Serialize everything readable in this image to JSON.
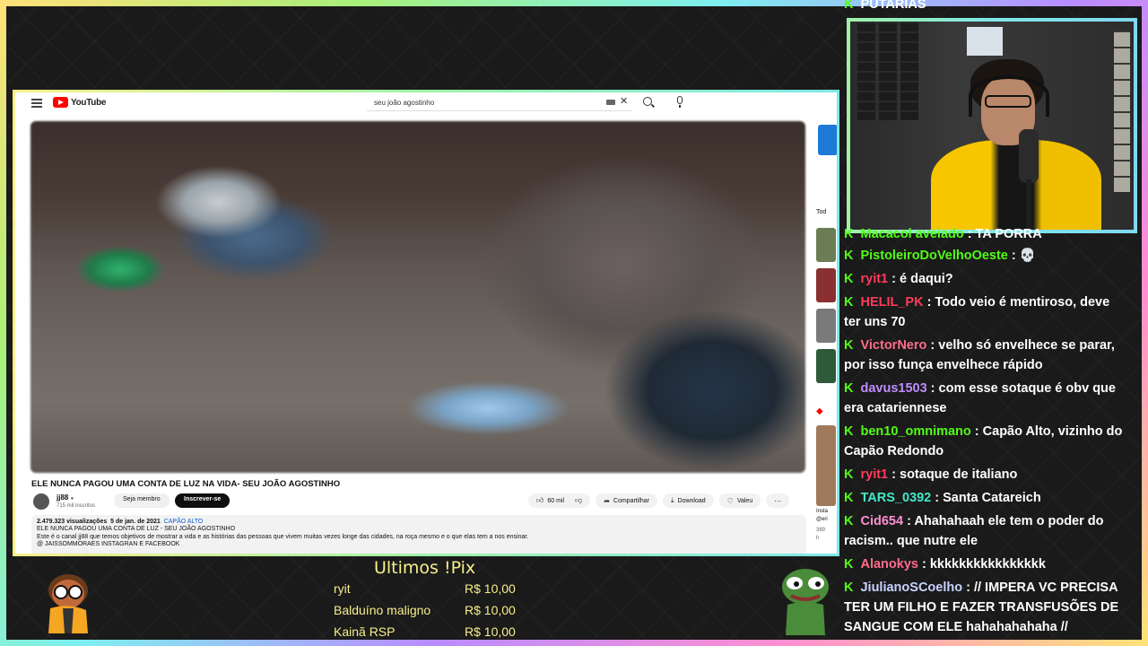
{
  "youtube": {
    "search_value": "seu joão agostinho",
    "logo_text": "YouTube",
    "video_title": "ELE NUNCA PAGOU UMA CONTA DE LUZ NA VIDA- SEU JOÃO AGOSTINHO",
    "channel_name": "jj88",
    "channel_subs": "715 mil inscritos",
    "member_label": "Seja membro",
    "subscribe_label": "Inscrever-se",
    "likes": "60 mil",
    "share_label": "Compartilhar",
    "download_label": "Download",
    "thanks_label": "Valeu",
    "views": "2.479.323 visualizações",
    "date": "5 de jan. de 2021",
    "location_tag": "CAPÃO ALTO",
    "desc_line1": "ELE NUNCA PAGOU UMA CONTA DE LUZ - SEU JOÃO AGOSTINHO",
    "desc_line2": "Este é o canal jj88 que temos objetivos de mostrar a vida e as histórias das pessoas que vivem muitas vezes longe das cidades, na roça mesmo e o que elas tem a nos ensinar.",
    "desc_line3": "@ JAISSOMMORAES INSTAGRAN E FACEBOOK",
    "right_filter": "Tod",
    "right_text1": "Insta",
    "right_text2": "@eri",
    "right_text3": "389",
    "right_text4": "h"
  },
  "chat": {
    "partial_top": "PUTARIAS",
    "messages": [
      {
        "user": "Macacol aveiado",
        "color": "#53fc18",
        "text": "TA PORRA"
      },
      {
        "user": "PistoleiroDoVelhoOeste",
        "color": "#53fc18",
        "text": "💀"
      },
      {
        "user": "ryit1",
        "color": "#ff3b5c",
        "text": "é daqui?"
      },
      {
        "user": "HELIL_PK",
        "color": "#ff3b5c",
        "text": "Todo veio é mentiroso, deve ter uns 70"
      },
      {
        "user": "VictorNero",
        "color": "#ff6b8a",
        "text": "velho só envelhece se parar, por isso funça envelhece rápido"
      },
      {
        "user": "davus1503",
        "color": "#c08cff",
        "text": "com esse sotaque é obv que era catariennese"
      },
      {
        "user": "ben10_omnimano",
        "color": "#53fc18",
        "text": "Capão Alto, vizinho do Capão Redondo"
      },
      {
        "user": "ryit1",
        "color": "#ff3b5c",
        "text": "sotaque de italiano"
      },
      {
        "user": "TARS_0392",
        "color": "#42e8c8",
        "text": "Santa Catareich"
      },
      {
        "user": "Cid654",
        "color": "#ff8fd0",
        "text": "Ahahahaah ele tem o poder do racism.. que nutre ele"
      },
      {
        "user": "Alanokys",
        "color": "#ff6b8a",
        "text": "kkkkkkkkkkkkkkkk"
      },
      {
        "user": "JiulianoSCoelho",
        "color": "#c8d4ff",
        "text": "// IMPERA VC PRECISA TER UM FILHO E FAZER TRANSFUSÕES DE SANGUE COM ELE hahahahahaha //"
      }
    ]
  },
  "pix": {
    "title": "Ultimos !Pix",
    "entries": [
      {
        "name": "ryit",
        "amount": "R$ 10,00"
      },
      {
        "name": "Balduíno maligno",
        "amount": "R$ 10,00"
      },
      {
        "name": "Kainã RSP",
        "amount": "R$ 10,00"
      }
    ]
  },
  "colors": {
    "kick_green": "#53fc18",
    "pix_yellow": "#f7ef8a",
    "yt_red": "#ff0000"
  }
}
